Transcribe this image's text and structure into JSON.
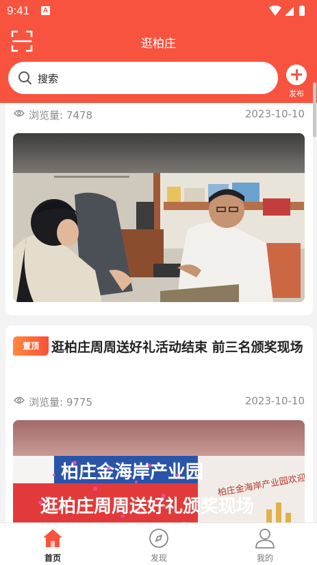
{
  "status_bar": {
    "time": "9:41",
    "indicator": "A"
  },
  "header": {
    "title": "逛柏庄",
    "scan_icon": "scan-icon"
  },
  "search": {
    "placeholder": "搜索"
  },
  "publish": {
    "label": "发布"
  },
  "posts": [
    {
      "views_label": "浏览量: 7478",
      "date": "2023-10-10",
      "image": "photo: woman in black beret talking with man in white t-shirt in an office"
    },
    {
      "tag": "置顶",
      "title": "逛柏庄周周送好礼活动结束 前三名颁奖现场",
      "views_label": "浏览量: 9775",
      "date": "2023-10-10",
      "image": "photo: banner 柏庄金海岸产业园 with confetti"
    }
  ],
  "tabs": [
    {
      "label": "首页",
      "icon": "home-icon",
      "active": true
    },
    {
      "label": "发现",
      "icon": "compass-icon",
      "active": false
    },
    {
      "label": "我的",
      "icon": "user-icon",
      "active": false
    }
  ],
  "colors": {
    "brand": "#f8533f",
    "tag_start": "#ff8a3d",
    "text_muted": "#8a8a8a"
  },
  "photo_banner_text": {
    "banner_main": "柏庄金海岸产业园",
    "banner_sub": "逛柏庄周周送好礼颁奖现场",
    "wall_sign": "柏庄金海岸产业园欢迎"
  }
}
